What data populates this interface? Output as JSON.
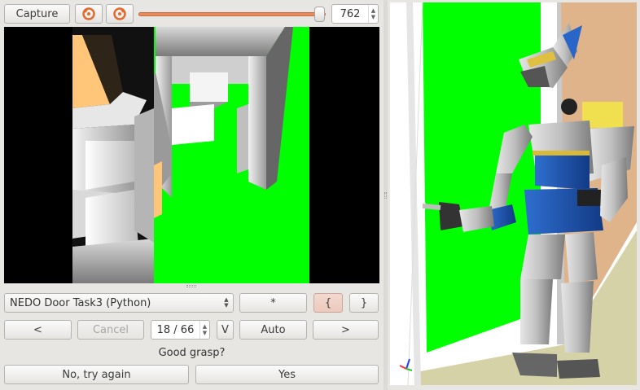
{
  "toolbar": {
    "capture_label": "Capture",
    "slider_value": "762",
    "slider_fraction": 0.97
  },
  "task": {
    "selected": "NEDO Door Task3 (Python)",
    "star_label": "*",
    "open_brace_label": "{",
    "close_brace_label": "}"
  },
  "nav": {
    "prev_label": "<",
    "cancel_label": "Cancel",
    "phase_value": "18 / 66",
    "v_label": "V",
    "auto_label": "Auto",
    "next_label": ">"
  },
  "message": "Good grasp?",
  "answers": {
    "no_label": "No, try again",
    "yes_label": "Yes"
  },
  "colors": {
    "accent": "#e98a5a",
    "screen_green": "#00ff00",
    "robot_blue": "#1a4fa8"
  }
}
